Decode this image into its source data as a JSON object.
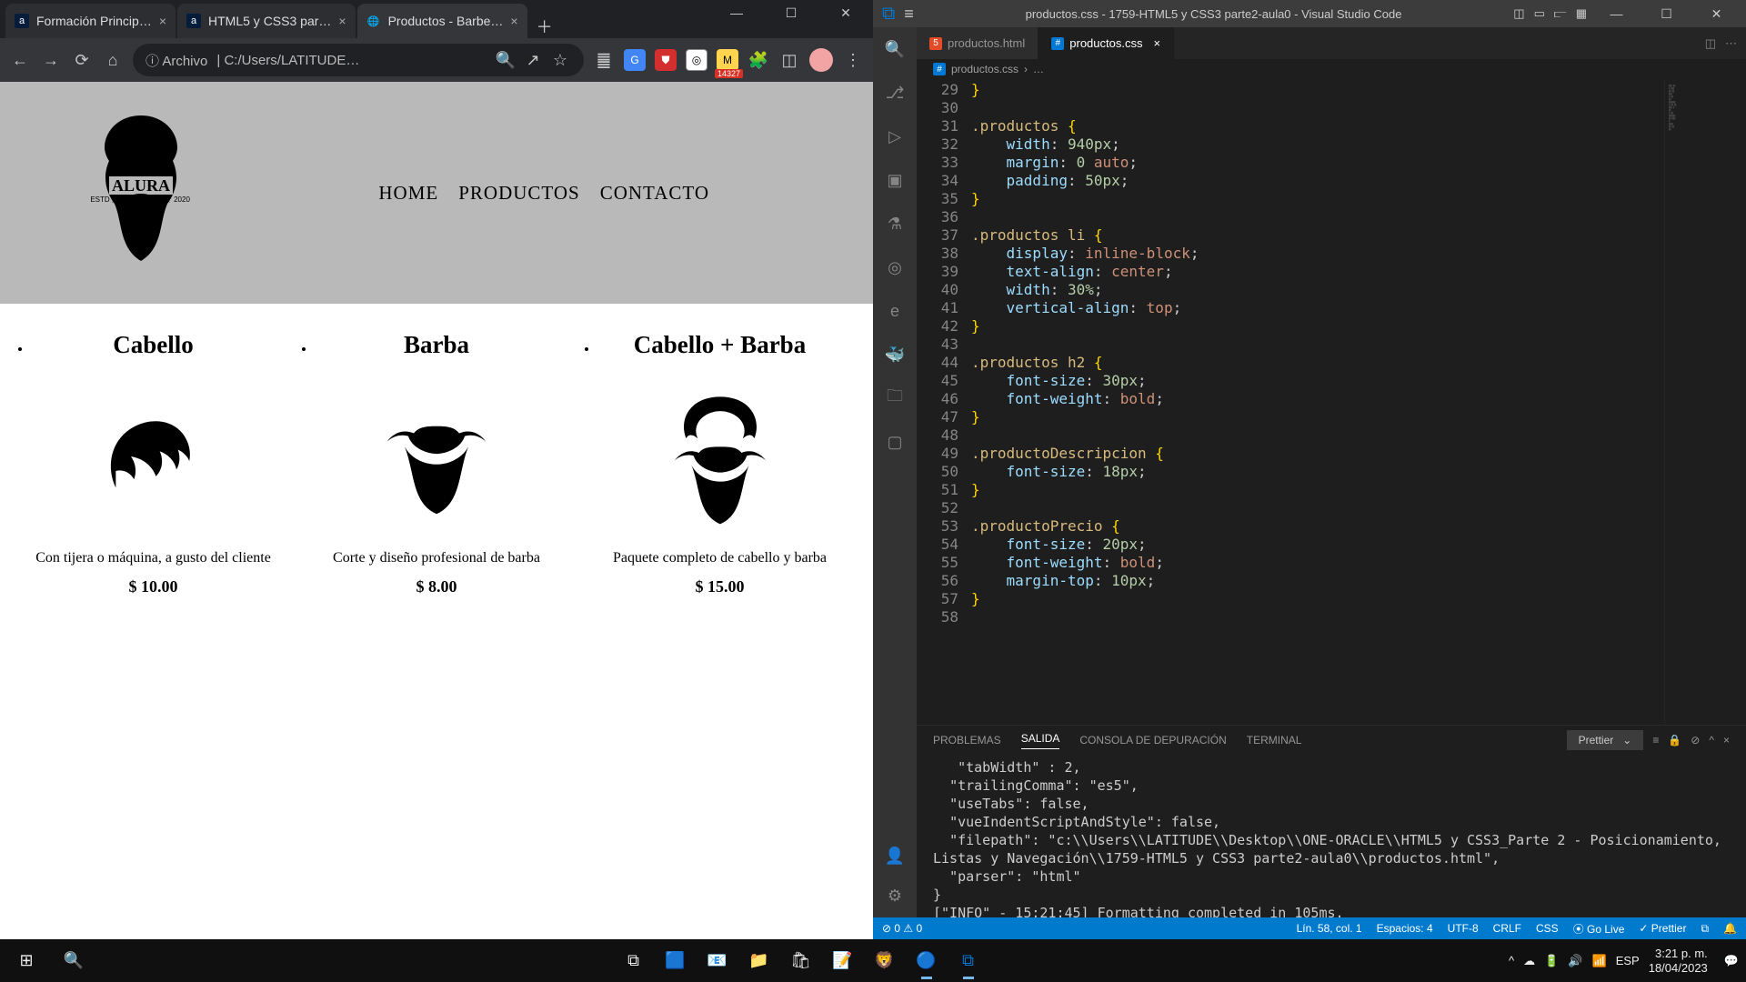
{
  "browser": {
    "tabs": [
      {
        "label": "Formación Princip…",
        "favicon": "a"
      },
      {
        "label": "HTML5 y CSS3 par…",
        "favicon": "a"
      },
      {
        "label": "Productos - Barbe…",
        "favicon": "globe",
        "active": true
      }
    ],
    "url_prefix": "ⓘ  Archivo",
    "url_path": "C:/Users/LATITUDE…",
    "nav": {
      "home": "HOME",
      "productos": "PRODUCTOS",
      "contacto": "CONTACTO"
    },
    "logo_top": "ALURA",
    "logo_left": "ESTD",
    "logo_right": "2020",
    "products": [
      {
        "title": "Cabello",
        "desc": "Con tijera o máquina, a gusto del cliente",
        "price": "$ 10.00"
      },
      {
        "title": "Barba",
        "desc": "Corte y diseño profesional de barba",
        "price": "$ 8.00"
      },
      {
        "title": "Cabello + Barba",
        "desc": "Paquete completo de cabello y barba",
        "price": "$ 15.00"
      }
    ],
    "badge": "14327"
  },
  "vscode": {
    "title": "productos.css - 1759-HTML5 y CSS3 parte2-aula0 - Visual Studio Code",
    "tabs": [
      {
        "label": "productos.html"
      },
      {
        "label": "productos.css",
        "active": true
      }
    ],
    "breadcrumb": {
      "file": "productos.css",
      "sep": "›",
      "more": "…"
    },
    "gutter_lines": [
      "29",
      "30",
      "31",
      "32",
      "33",
      "34",
      "35",
      "36",
      "37",
      "38",
      "39",
      "40",
      "41",
      "42",
      "43",
      "44",
      "45",
      "46",
      "47",
      "48",
      "49",
      "50",
      "51",
      "52",
      "53",
      "54",
      "55",
      "56",
      "57",
      "58"
    ],
    "panel": {
      "tabs": {
        "problems": "PROBLEMAS",
        "output": "SALIDA",
        "debug": "CONSOLA DE DEPURACIÓN",
        "terminal": "TERMINAL"
      },
      "selector": "Prettier",
      "output_lines": [
        "   \"tabWidth\" : 2,",
        "  \"trailingComma\": \"es5\",",
        "  \"useTabs\": false,",
        "  \"vueIndentScriptAndStyle\": false,",
        "  \"filepath\": \"c:\\\\Users\\\\LATITUDE\\\\Desktop\\\\ONE-ORACLE\\\\HTML5 y CSS3_Parte 2 - Posicionamiento, Listas y Navegación\\\\1759-HTML5 y CSS3 parte2-aula0\\\\productos.html\",",
        "  \"parser\": \"html\"",
        "}",
        "[\"INFO\" - 15:21:45] Formatting completed in 105ms."
      ]
    },
    "status": {
      "errors": "⊘ 0 ⚠ 0",
      "pos": "Lín. 58, col. 1",
      "spaces": "Espacios: 4",
      "enc": "UTF-8",
      "eol": "CRLF",
      "lang": "CSS",
      "golive": "⦿ Go Live",
      "prettier": "✓ Prettier"
    }
  },
  "taskbar": {
    "time": "3:21 p. m.",
    "date": "18/04/2023",
    "lang": "ESP"
  }
}
